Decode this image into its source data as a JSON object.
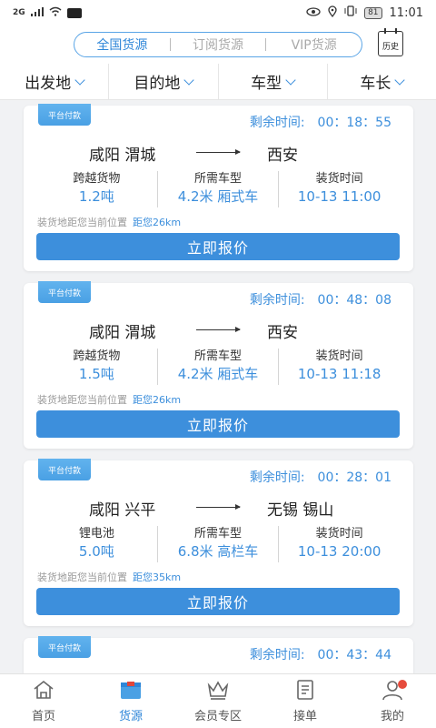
{
  "status": {
    "signal": "2G",
    "battery": "81",
    "time": "11:01"
  },
  "header": {
    "tabs": [
      "全国货源",
      "订阅货源",
      "VIP货源"
    ],
    "history_label": "历史"
  },
  "filters": [
    "出发地",
    "目的地",
    "车型",
    "车长"
  ],
  "cards": [
    {
      "badge": "平台付款",
      "timer_label": "剩余时间:",
      "timer": "00：18：55",
      "from": "咸阳 渭城",
      "to": "西安",
      "cargo_label": "跨越货物",
      "cargo_value": "1.2吨",
      "vehicle_label": "所需车型",
      "vehicle_value": "4.2米 厢式车",
      "load_label": "装货时间",
      "load_value": "10-13 11:00",
      "hint": "装货地距您当前位置",
      "distance": "距您26km",
      "button": "立即报价"
    },
    {
      "badge": "平台付款",
      "timer_label": "剩余时间:",
      "timer": "00：48：08",
      "from": "咸阳 渭城",
      "to": "西安",
      "cargo_label": "跨越货物",
      "cargo_value": "1.5吨",
      "vehicle_label": "所需车型",
      "vehicle_value": "4.2米 厢式车",
      "load_label": "装货时间",
      "load_value": "10-13 11:18",
      "hint": "装货地距您当前位置",
      "distance": "距您26km",
      "button": "立即报价"
    },
    {
      "badge": "平台付款",
      "timer_label": "剩余时间:",
      "timer": "00：28：01",
      "from": "咸阳 兴平",
      "to": "无锡 锡山",
      "cargo_label": "锂电池",
      "cargo_value": "5.0吨",
      "vehicle_label": "所需车型",
      "vehicle_value": "6.8米 高栏车",
      "load_label": "装货时间",
      "load_value": "10-13 20:00",
      "hint": "装货地距您当前位置",
      "distance": "距您35km",
      "button": "立即报价"
    },
    {
      "badge": "平台付款",
      "timer_label": "剩余时间:",
      "timer": "00：43：44"
    }
  ],
  "tabbar": [
    "首页",
    "货源",
    "会员专区",
    "接单",
    "我的"
  ],
  "colors": {
    "accent": "#3d8fdc",
    "badge_dot": "#e64b3c"
  }
}
